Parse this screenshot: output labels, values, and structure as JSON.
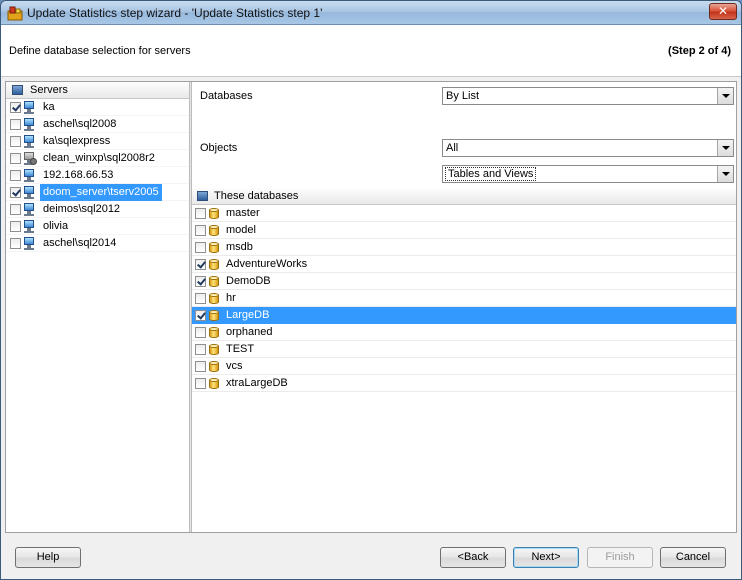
{
  "window": {
    "title": "Update Statistics step wizard - 'Update Statistics step 1'",
    "close_glyph": "✕"
  },
  "header": {
    "description": "Define database selection for servers",
    "step": "(Step 2 of 4)"
  },
  "servers": {
    "header": "Servers",
    "items": [
      {
        "name": "ka",
        "checked": true,
        "selected": false,
        "icon": "monitor-icon"
      },
      {
        "name": "aschel\\sql2008",
        "checked": false,
        "selected": false,
        "icon": "monitor-icon"
      },
      {
        "name": "ka\\sqlexpress",
        "checked": false,
        "selected": false,
        "icon": "monitor-icon"
      },
      {
        "name": "clean_winxp\\sql2008r2",
        "checked": false,
        "selected": false,
        "icon": "disconnected-server-icon"
      },
      {
        "name": "192.168.66.53",
        "checked": false,
        "selected": false,
        "icon": "monitor-icon"
      },
      {
        "name": "doom_server\\tserv2005",
        "checked": true,
        "selected": true,
        "icon": "monitor-icon"
      },
      {
        "name": "deimos\\sql2012",
        "checked": false,
        "selected": false,
        "icon": "monitor-icon"
      },
      {
        "name": "olivia",
        "checked": false,
        "selected": false,
        "icon": "monitor-icon"
      },
      {
        "name": "aschel\\sql2014",
        "checked": false,
        "selected": false,
        "icon": "monitor-icon"
      }
    ]
  },
  "selection": {
    "databases_label": "Databases",
    "databases_value": "By List",
    "objects_label": "Objects",
    "objects_value": "All",
    "object_type_value": "Tables and Views"
  },
  "databases": {
    "header": "These databases",
    "items": [
      {
        "name": "master",
        "checked": false,
        "selected": false
      },
      {
        "name": "model",
        "checked": false,
        "selected": false
      },
      {
        "name": "msdb",
        "checked": false,
        "selected": false
      },
      {
        "name": "AdventureWorks",
        "checked": true,
        "selected": false
      },
      {
        "name": "DemoDB",
        "checked": true,
        "selected": false
      },
      {
        "name": "hr",
        "checked": false,
        "selected": false
      },
      {
        "name": "LargeDB",
        "checked": true,
        "selected": true
      },
      {
        "name": "orphaned",
        "checked": false,
        "selected": false
      },
      {
        "name": "TEST",
        "checked": false,
        "selected": false
      },
      {
        "name": "vcs",
        "checked": false,
        "selected": false
      },
      {
        "name": "xtraLargeDB",
        "checked": false,
        "selected": false
      }
    ]
  },
  "footer": {
    "help": "Help",
    "back": "<Back",
    "next": "Next>",
    "finish": "Finish",
    "cancel": "Cancel"
  }
}
